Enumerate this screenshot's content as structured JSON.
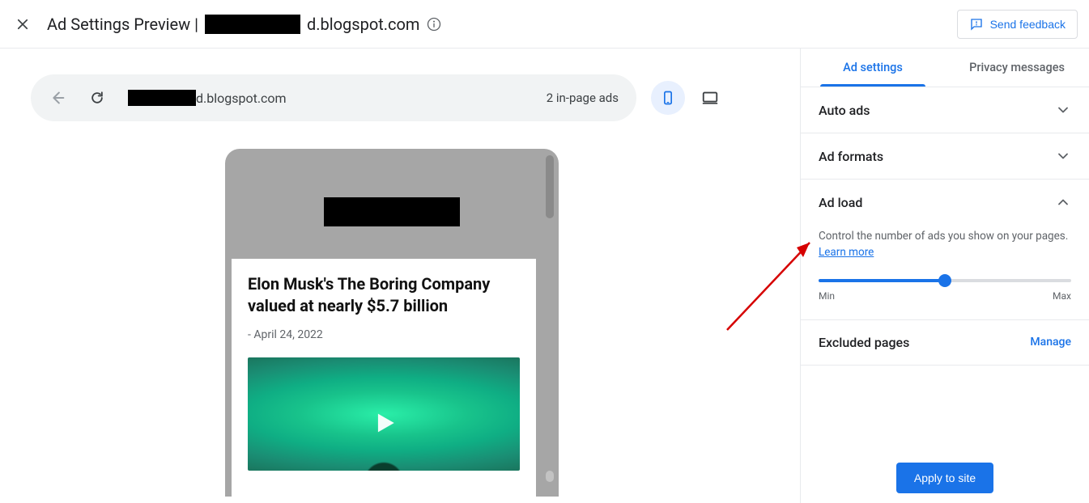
{
  "header": {
    "title_prefix": "Ad Settings Preview | ",
    "title_suffix": "d.blogspot.com",
    "feedback_label": "Send feedback"
  },
  "urlbar": {
    "url_suffix": "d.blogspot.com",
    "ad_count_text": "2 in-page ads"
  },
  "preview": {
    "article_title": "Elon Musk's The Boring Company valued at nearly $5.7 billion",
    "article_date": "- April 24, 2022"
  },
  "side": {
    "tabs": {
      "settings": "Ad settings",
      "privacy": "Privacy messages"
    },
    "sections": {
      "auto_ads": "Auto ads",
      "ad_formats": "Ad formats",
      "ad_load": "Ad load",
      "excluded": "Excluded pages"
    },
    "ad_load": {
      "desc_prefix": "Control the number of ads you show on your pages. ",
      "learn_more": "Learn more",
      "min": "Min",
      "max": "Max",
      "value_percent": 50
    },
    "manage_label": "Manage",
    "apply_label": "Apply to site"
  }
}
